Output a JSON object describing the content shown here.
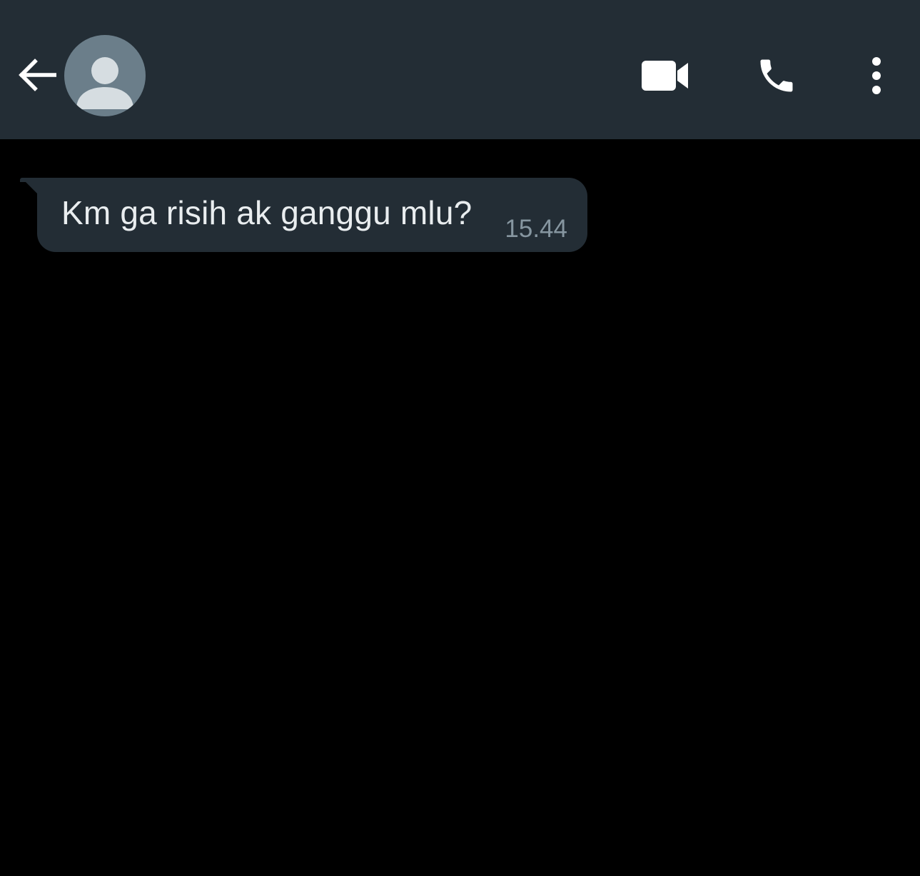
{
  "header": {
    "back_icon": "arrow-left-icon",
    "avatar_icon": "default-person-icon",
    "actions": [
      {
        "name": "video-call",
        "icon": "video-camera-icon"
      },
      {
        "name": "voice-call",
        "icon": "phone-icon"
      },
      {
        "name": "more-options",
        "icon": "vertical-dots-icon"
      }
    ]
  },
  "messages": [
    {
      "direction": "incoming",
      "text": "Km ga risih ak ganggu mlu?",
      "time": "15.44"
    }
  ],
  "colors": {
    "header_bg": "#232d35",
    "chat_bg": "#000000",
    "bubble_bg": "#232d35",
    "message_text": "#e9edef",
    "timestamp_text": "#8696a0",
    "icon_color": "#ffffff",
    "avatar_bg": "#6b7e8a",
    "avatar_fg": "#d6dde1"
  }
}
